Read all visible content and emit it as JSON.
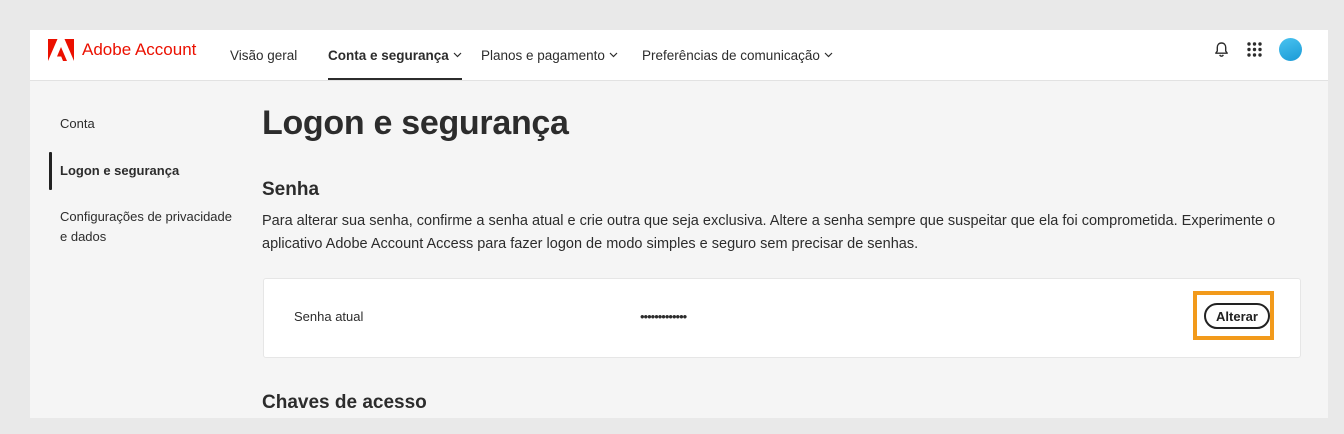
{
  "header": {
    "brand": "Adobe Account",
    "nav": [
      {
        "label": "Visão geral",
        "active": false,
        "dropdown": false
      },
      {
        "label": "Conta e segurança",
        "active": true,
        "dropdown": true
      },
      {
        "label": "Planos e pagamento",
        "active": false,
        "dropdown": true
      },
      {
        "label": "Preferências de comunicação",
        "active": false,
        "dropdown": true
      }
    ],
    "icons": [
      "bell-icon",
      "apps-grid-icon",
      "avatar"
    ]
  },
  "sidebar": {
    "items": [
      {
        "label": "Conta",
        "active": false
      },
      {
        "label": "Logon e segurança",
        "active": true
      },
      {
        "label": "Configurações de privacidade e dados",
        "active": false
      }
    ]
  },
  "main": {
    "title": "Logon e segurança",
    "password_section": {
      "title": "Senha",
      "description": "Para alterar sua senha, confirme a senha atual e crie outra que seja exclusiva. Altere a senha sempre que suspeitar que ela foi comprometida. Experimente o aplicativo Adobe Account Access para fazer logon de modo simples e seguro sem precisar de senhas.",
      "field_label": "Senha atual",
      "field_value": "•••••••••••••",
      "button_label": "Alterar"
    },
    "passkeys_section": {
      "title": "Chaves de acesso"
    }
  },
  "colors": {
    "brand_red": "#eb1000",
    "highlight_orange": "#f29a1b"
  }
}
